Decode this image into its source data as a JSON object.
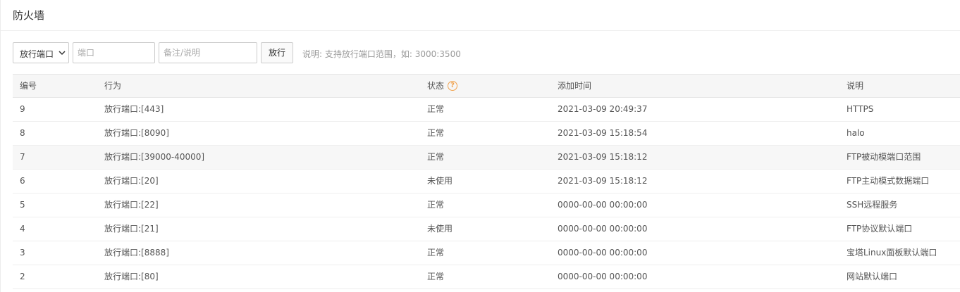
{
  "header": {
    "title": "防火墙"
  },
  "toolbar": {
    "action_select": {
      "selected": "放行端口",
      "icon": "chevron-down-icon"
    },
    "port_input": {
      "placeholder": "端口",
      "value": ""
    },
    "note_input": {
      "placeholder": "备注/说明",
      "value": ""
    },
    "submit_label": "放行",
    "hint": "说明: 支持放行端口范围，如: 3000:3500"
  },
  "table": {
    "columns": [
      "编号",
      "行为",
      "状态",
      "添加时间",
      "说明"
    ],
    "status_help_icon": "?",
    "rows": [
      {
        "id": "9",
        "action": "放行端口:[443]",
        "status": "正常",
        "added": "2021-03-09 20:49:37",
        "note": "HTTPS"
      },
      {
        "id": "8",
        "action": "放行端口:[8090]",
        "status": "正常",
        "added": "2021-03-09 15:18:54",
        "note": "halo"
      },
      {
        "id": "7",
        "action": "放行端口:[39000-40000]",
        "status": "正常",
        "added": "2021-03-09 15:18:12",
        "note": "FTP被动模端口范围"
      },
      {
        "id": "6",
        "action": "放行端口:[20]",
        "status": "未使用",
        "added": "2021-03-09 15:18:12",
        "note": "FTP主动模式数据端口"
      },
      {
        "id": "5",
        "action": "放行端口:[22]",
        "status": "正常",
        "added": "0000-00-00 00:00:00",
        "note": "SSH远程服务"
      },
      {
        "id": "4",
        "action": "放行端口:[21]",
        "status": "未使用",
        "added": "0000-00-00 00:00:00",
        "note": "FTP协议默认端口"
      },
      {
        "id": "3",
        "action": "放行端口:[8888]",
        "status": "正常",
        "added": "0000-00-00 00:00:00",
        "note": "宝塔Linux面板默认端口"
      },
      {
        "id": "2",
        "action": "放行端口:[80]",
        "status": "正常",
        "added": "0000-00-00 00:00:00",
        "note": "网站默认端口"
      }
    ]
  },
  "colors": {
    "accent_help": "#f0a04a",
    "header_bg": "#f6f6f6",
    "hover_row_bg": "#f7f7f7"
  }
}
